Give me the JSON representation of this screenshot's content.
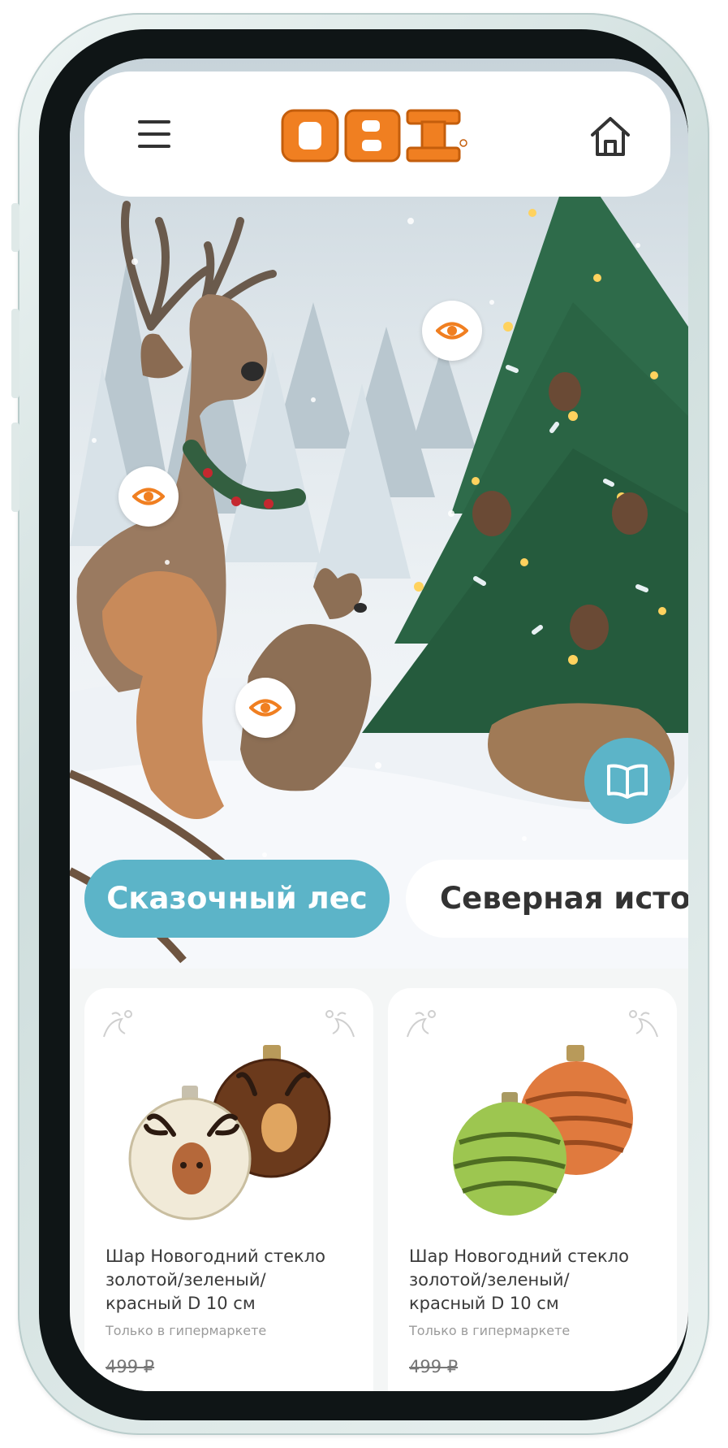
{
  "header": {
    "logo_text": "OBI",
    "menu_icon": "hamburger-menu-icon",
    "home_icon": "home-icon"
  },
  "hero": {
    "hotspot_icon": "eye-icon",
    "catalog_icon": "open-book-icon"
  },
  "categories": [
    {
      "label": "Сказочный лес",
      "active": true
    },
    {
      "label": "Северная истор",
      "active": false
    }
  ],
  "products": [
    {
      "name_lines": [
        "Шар Новогодний стекло",
        "золотой/зеленый/",
        "красный D 10 см"
      ],
      "availability": "Только в гипермаркете",
      "price": "499 ₽"
    },
    {
      "name_lines": [
        "Шар Новогодний стекло",
        "золотой/зеленый/",
        "красный D 10 см"
      ],
      "availability": "Только в гипермаркете",
      "price": "499 ₽"
    }
  ],
  "colors": {
    "accent": "#5cb4c8",
    "brand_orange": "#f07f21",
    "phone_frame": "#cfdedd",
    "bezel": "#0f1516"
  }
}
